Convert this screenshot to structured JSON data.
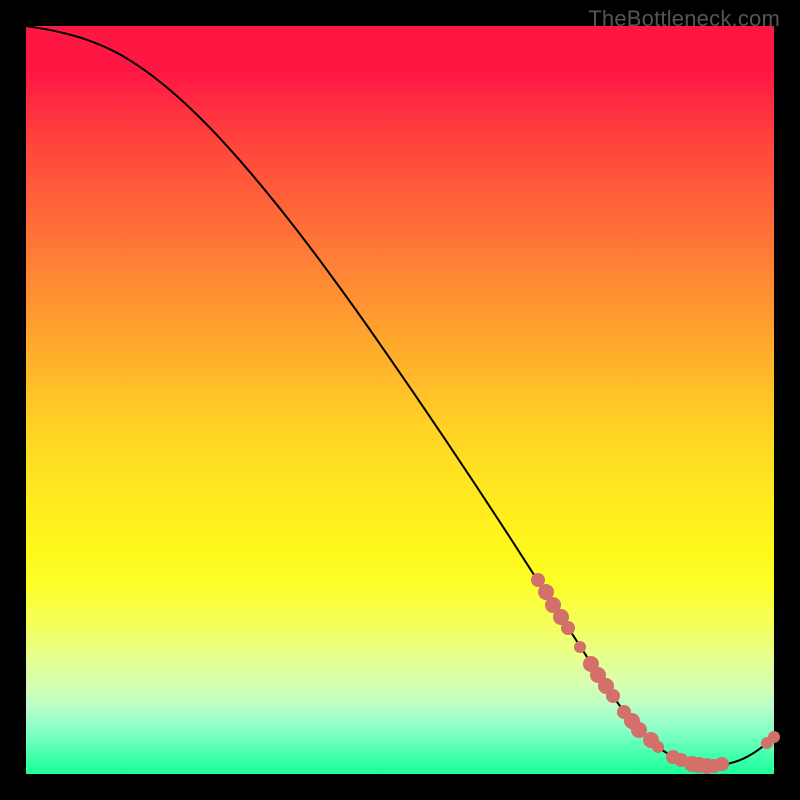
{
  "watermark": "TheBottleneck.com",
  "colors": {
    "marker": "#d27069",
    "curve": "#000000",
    "page_bg": "#000000"
  },
  "chart_data": {
    "type": "line",
    "title": "",
    "xlabel": "",
    "ylabel": "",
    "xlim": [
      0,
      100
    ],
    "ylim": [
      0,
      100
    ],
    "curve": {
      "x": [
        0,
        4,
        8,
        12,
        16,
        20,
        24,
        28,
        32,
        36,
        40,
        44,
        48,
        52,
        56,
        60,
        64,
        68,
        70,
        72,
        74,
        76,
        78,
        80,
        82,
        84,
        86,
        88,
        90,
        92,
        94,
        96,
        98,
        100
      ],
      "y": [
        100,
        99.3,
        98.2,
        96.5,
        94.0,
        90.8,
        87.0,
        82.7,
        78.0,
        73.0,
        67.7,
        62.2,
        56.5,
        50.7,
        44.8,
        38.8,
        32.7,
        26.5,
        23.4,
        20.3,
        17.2,
        14.1,
        11.1,
        8.3,
        5.9,
        4.0,
        2.6,
        1.7,
        1.2,
        1.1,
        1.4,
        2.1,
        3.3,
        5.0
      ]
    },
    "markers": [
      {
        "x": 68.5,
        "y": 25.9,
        "r": 7
      },
      {
        "x": 69.5,
        "y": 24.3,
        "r": 8
      },
      {
        "x": 70.5,
        "y": 22.6,
        "r": 8
      },
      {
        "x": 71.5,
        "y": 21.0,
        "r": 8
      },
      {
        "x": 72.5,
        "y": 19.5,
        "r": 7
      },
      {
        "x": 74.0,
        "y": 17.0,
        "r": 6
      },
      {
        "x": 75.5,
        "y": 14.7,
        "r": 8
      },
      {
        "x": 76.5,
        "y": 13.2,
        "r": 8
      },
      {
        "x": 77.5,
        "y": 11.8,
        "r": 8
      },
      {
        "x": 78.5,
        "y": 10.4,
        "r": 7
      },
      {
        "x": 80.0,
        "y": 8.3,
        "r": 7
      },
      {
        "x": 81.0,
        "y": 7.1,
        "r": 8
      },
      {
        "x": 82.0,
        "y": 5.9,
        "r": 8
      },
      {
        "x": 83.5,
        "y": 4.5,
        "r": 8
      },
      {
        "x": 84.5,
        "y": 3.6,
        "r": 6
      },
      {
        "x": 86.5,
        "y": 2.3,
        "r": 7
      },
      {
        "x": 87.5,
        "y": 1.9,
        "r": 7
      },
      {
        "x": 89.0,
        "y": 1.4,
        "r": 8
      },
      {
        "x": 90.0,
        "y": 1.2,
        "r": 8
      },
      {
        "x": 91.0,
        "y": 1.1,
        "r": 8
      },
      {
        "x": 92.0,
        "y": 1.1,
        "r": 7
      },
      {
        "x": 93.0,
        "y": 1.3,
        "r": 7
      },
      {
        "x": 99.0,
        "y": 4.1,
        "r": 6
      },
      {
        "x": 100.0,
        "y": 5.0,
        "r": 6
      }
    ]
  }
}
